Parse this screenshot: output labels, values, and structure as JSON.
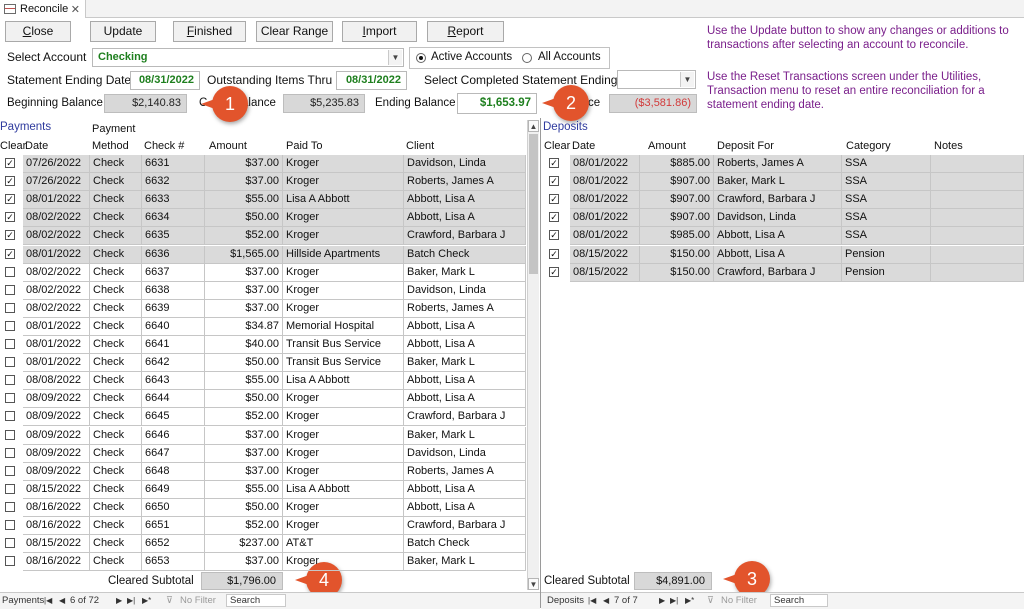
{
  "tab": {
    "title": "Reconcile",
    "close": "✕"
  },
  "toolbar": [
    {
      "id": "close",
      "label": "Close",
      "underline": "C",
      "rest": "lose"
    },
    {
      "id": "update",
      "label": "Update",
      "underline": "",
      "rest": "Update"
    },
    {
      "id": "finished",
      "label": "Finished",
      "underline": "F",
      "rest": "inished"
    },
    {
      "id": "clear-range",
      "label": "Clear Range",
      "underline": "",
      "rest": "Clear Range"
    },
    {
      "id": "import",
      "label": "Import",
      "underline": "I",
      "rest": "mport"
    },
    {
      "id": "report",
      "label": "Report",
      "underline": "R",
      "rest": "eport"
    }
  ],
  "form": {
    "select_account_label": "Select Account",
    "account_value": "Checking",
    "active_accounts": "Active Accounts",
    "all_accounts": "All Accounts",
    "statement_ending_date_label": "Statement Ending Date",
    "statement_ending_date": "08/31/2022",
    "outstanding_items_thru_label": "Outstanding Items Thru",
    "outstanding_items_thru": "08/31/2022",
    "select_completed_label": "Select Completed Statement Ending",
    "select_completed_value": "",
    "beginning_balance_label": "Beginning Balance",
    "beginning_balance": "$2,140.83",
    "cleared_balance_label_visible": "C",
    "cleared_balance_label_tail": "alance",
    "cleared_balance": "$5,235.83",
    "ending_balance_label": "Ending Balance",
    "ending_balance": "$1,653.97",
    "difference_label_tail": "ce",
    "difference": "($3,581.86)"
  },
  "help": {
    "line1": "Use the Update button to show any changes or additions to transactions after selecting an account to reconcile.",
    "line2": "Use the Reset Transactions screen under the Utilities, Transaction menu to reset an entire reconciliation for a statement ending date."
  },
  "callouts": [
    "1",
    "2",
    "3",
    "4"
  ],
  "payments": {
    "title": "Payments",
    "headers": {
      "clear": "Clear",
      "date": "Date",
      "method_top": "Payment",
      "method": "Method",
      "check": "Check #",
      "amount": "Amount",
      "paid_to": "Paid To",
      "client": "Client"
    },
    "rows": [
      {
        "cleared": true,
        "date": "07/26/2022",
        "method": "Check",
        "check": "6631",
        "amount": "$37.00",
        "paid_to": "Kroger",
        "client": "Davidson, Linda"
      },
      {
        "cleared": true,
        "date": "07/26/2022",
        "method": "Check",
        "check": "6632",
        "amount": "$37.00",
        "paid_to": "Kroger",
        "client": "Roberts, James A"
      },
      {
        "cleared": true,
        "date": "08/01/2022",
        "method": "Check",
        "check": "6633",
        "amount": "$55.00",
        "paid_to": "Lisa A Abbott",
        "client": "Abbott, Lisa A"
      },
      {
        "cleared": true,
        "date": "08/02/2022",
        "method": "Check",
        "check": "6634",
        "amount": "$50.00",
        "paid_to": "Kroger",
        "client": "Abbott, Lisa A"
      },
      {
        "cleared": true,
        "date": "08/02/2022",
        "method": "Check",
        "check": "6635",
        "amount": "$52.00",
        "paid_to": "Kroger",
        "client": "Crawford, Barbara J"
      },
      {
        "cleared": true,
        "date": "08/01/2022",
        "method": "Check",
        "check": "6636",
        "amount": "$1,565.00",
        "paid_to": "Hillside Apartments",
        "client": "Batch Check"
      },
      {
        "cleared": false,
        "date": "08/02/2022",
        "method": "Check",
        "check": "6637",
        "amount": "$37.00",
        "paid_to": "Kroger",
        "client": "Baker, Mark L"
      },
      {
        "cleared": false,
        "date": "08/02/2022",
        "method": "Check",
        "check": "6638",
        "amount": "$37.00",
        "paid_to": "Kroger",
        "client": "Davidson, Linda"
      },
      {
        "cleared": false,
        "date": "08/02/2022",
        "method": "Check",
        "check": "6639",
        "amount": "$37.00",
        "paid_to": "Kroger",
        "client": "Roberts, James A"
      },
      {
        "cleared": false,
        "date": "08/01/2022",
        "method": "Check",
        "check": "6640",
        "amount": "$34.87",
        "paid_to": "Memorial Hospital",
        "client": "Abbott, Lisa A"
      },
      {
        "cleared": false,
        "date": "08/01/2022",
        "method": "Check",
        "check": "6641",
        "amount": "$40.00",
        "paid_to": "Transit Bus Service",
        "client": "Abbott, Lisa A"
      },
      {
        "cleared": false,
        "date": "08/01/2022",
        "method": "Check",
        "check": "6642",
        "amount": "$50.00",
        "paid_to": "Transit Bus Service",
        "client": "Baker, Mark L"
      },
      {
        "cleared": false,
        "date": "08/08/2022",
        "method": "Check",
        "check": "6643",
        "amount": "$55.00",
        "paid_to": "Lisa A Abbott",
        "client": "Abbott, Lisa A"
      },
      {
        "cleared": false,
        "date": "08/09/2022",
        "method": "Check",
        "check": "6644",
        "amount": "$50.00",
        "paid_to": "Kroger",
        "client": "Abbott, Lisa A"
      },
      {
        "cleared": false,
        "date": "08/09/2022",
        "method": "Check",
        "check": "6645",
        "amount": "$52.00",
        "paid_to": "Kroger",
        "client": "Crawford, Barbara J"
      },
      {
        "cleared": false,
        "date": "08/09/2022",
        "method": "Check",
        "check": "6646",
        "amount": "$37.00",
        "paid_to": "Kroger",
        "client": "Baker, Mark L"
      },
      {
        "cleared": false,
        "date": "08/09/2022",
        "method": "Check",
        "check": "6647",
        "amount": "$37.00",
        "paid_to": "Kroger",
        "client": "Davidson, Linda"
      },
      {
        "cleared": false,
        "date": "08/09/2022",
        "method": "Check",
        "check": "6648",
        "amount": "$37.00",
        "paid_to": "Kroger",
        "client": "Roberts, James A"
      },
      {
        "cleared": false,
        "date": "08/15/2022",
        "method": "Check",
        "check": "6649",
        "amount": "$55.00",
        "paid_to": "Lisa A Abbott",
        "client": "Abbott, Lisa A"
      },
      {
        "cleared": false,
        "date": "08/16/2022",
        "method": "Check",
        "check": "6650",
        "amount": "$50.00",
        "paid_to": "Kroger",
        "client": "Abbott, Lisa A"
      },
      {
        "cleared": false,
        "date": "08/16/2022",
        "method": "Check",
        "check": "6651",
        "amount": "$52.00",
        "paid_to": "Kroger",
        "client": "Crawford, Barbara J"
      },
      {
        "cleared": false,
        "date": "08/15/2022",
        "method": "Check",
        "check": "6652",
        "amount": "$237.00",
        "paid_to": "AT&T",
        "client": "Batch Check"
      },
      {
        "cleared": false,
        "date": "08/16/2022",
        "method": "Check",
        "check": "6653",
        "amount": "$37.00",
        "paid_to": "Kroger",
        "client": "Baker, Mark L"
      }
    ],
    "subtotal_label": "Cleared Subtotal",
    "subtotal": "$1,796.00",
    "nav": {
      "label": "Payments",
      "record": "6 of 72",
      "no_filter": "No Filter",
      "search": "Search"
    }
  },
  "deposits": {
    "title": "Deposits",
    "headers": {
      "clear": "Clear",
      "date": "Date",
      "amount": "Amount",
      "deposit_for": "Deposit For",
      "category": "Category",
      "notes": "Notes"
    },
    "rows": [
      {
        "cleared": true,
        "date": "08/01/2022",
        "amount": "$885.00",
        "deposit_for": "Roberts, James A",
        "category": "SSA",
        "notes": ""
      },
      {
        "cleared": true,
        "date": "08/01/2022",
        "amount": "$907.00",
        "deposit_for": "Baker, Mark L",
        "category": "SSA",
        "notes": ""
      },
      {
        "cleared": true,
        "date": "08/01/2022",
        "amount": "$907.00",
        "deposit_for": "Crawford, Barbara J",
        "category": "SSA",
        "notes": ""
      },
      {
        "cleared": true,
        "date": "08/01/2022",
        "amount": "$907.00",
        "deposit_for": "Davidson, Linda",
        "category": "SSA",
        "notes": ""
      },
      {
        "cleared": true,
        "date": "08/01/2022",
        "amount": "$985.00",
        "deposit_for": "Abbott, Lisa A",
        "category": "SSA",
        "notes": ""
      },
      {
        "cleared": true,
        "date": "08/15/2022",
        "amount": "$150.00",
        "deposit_for": "Abbott, Lisa A",
        "category": "Pension",
        "notes": ""
      },
      {
        "cleared": true,
        "date": "08/15/2022",
        "amount": "$150.00",
        "deposit_for": "Crawford, Barbara J",
        "category": "Pension",
        "notes": ""
      }
    ],
    "subtotal_label": "Cleared Subtotal",
    "subtotal": "$4,891.00",
    "nav": {
      "label": "Deposits",
      "record": "7 of 7",
      "no_filter": "No Filter",
      "search": "Search"
    }
  },
  "colors": {
    "help_text": "#7a1f8b",
    "value_green": "#1e7f1e",
    "value_red": "#d23a3a",
    "callout": "#e2542c",
    "section_title": "#2f3b9e"
  }
}
